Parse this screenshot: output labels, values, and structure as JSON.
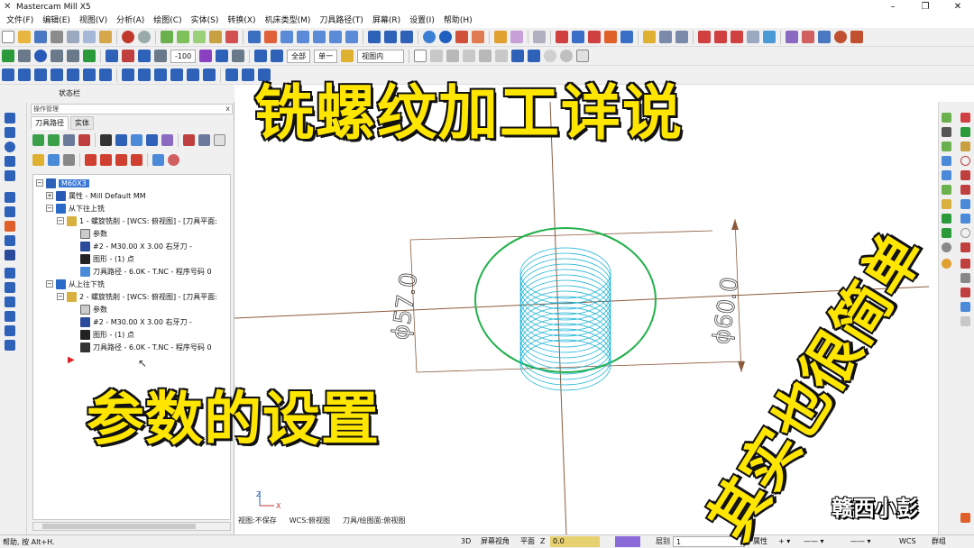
{
  "window": {
    "title": "Mastercam Mill X5",
    "app_icon": "mastercam-x-icon",
    "controls": [
      "–",
      "❐",
      "✕"
    ]
  },
  "menu": [
    "文件(F)",
    "编辑(E)",
    "视图(V)",
    "分析(A)",
    "绘图(C)",
    "实体(S)",
    "转换(X)",
    "机床类型(M)",
    "刀具路径(T)",
    "屏幕(R)",
    "设置(I)",
    "帮助(H)"
  ],
  "toolbar": {
    "zoom_field": "-100",
    "select_all": "全部",
    "select_single": "单一",
    "view_mode": "视图内"
  },
  "status_row_label": "状态栏",
  "ops_panel": {
    "header": "操作管理",
    "close": "x",
    "tabs": [
      "刀具路径",
      "实体"
    ],
    "root": "M60X3",
    "properties": "属性 - Mill Default MM",
    "group1": {
      "name": "从下往上铣",
      "op": "1 - 螺旋铣削 - [WCS: 俯视图] - [刀具平面:",
      "params": "参数",
      "tool": "#2 - M30.00 X 3.00 右牙刀 -",
      "geometry": "图形 - (1) 点",
      "toolpath": "刀具路径 - 6.0K - T.NC - 程序号码 0"
    },
    "group2": {
      "name": "从上往下铣",
      "op": "2 - 螺旋铣削 - [WCS: 俯视图] - [刀具平面:",
      "params": "参数",
      "tool": "#2 - M30.00 X 3.00 右牙刀 -",
      "geometry": "图形 - (1) 点",
      "toolpath": "刀具路径 - 6.0K - T.NC - 程序号码 0"
    }
  },
  "viewport": {
    "dim_left": "ϕ57.0",
    "dim_right": "ϕ60.0",
    "axis_z": "Z",
    "axis_x": "X",
    "status": [
      "视图:不保存",
      "WCS:俯视图",
      "刀具/绘图面:俯视图"
    ]
  },
  "statusbar": {
    "help": "帮助, 按 Alt+H.",
    "mode_3d": "3D",
    "screen_view": "屏幕视角",
    "plane": "平面",
    "z_label": "Z",
    "z_value": "0.0",
    "level_label": "层别",
    "level_value": "1",
    "attr": "属性",
    "wcs": "WCS",
    "group": "群组"
  },
  "captions": {
    "title": "铣螺纹加工详说",
    "left": "参数的设置",
    "right": "其实也很简单",
    "watermark": "赣西小彭"
  },
  "colors": {
    "caption_fill": "#ffe600",
    "circle_green": "#22b14c",
    "helix_cyan": "#1ab3d6",
    "axis_brown": "#8b5a3c",
    "selection_blue": "#3a78d6"
  }
}
